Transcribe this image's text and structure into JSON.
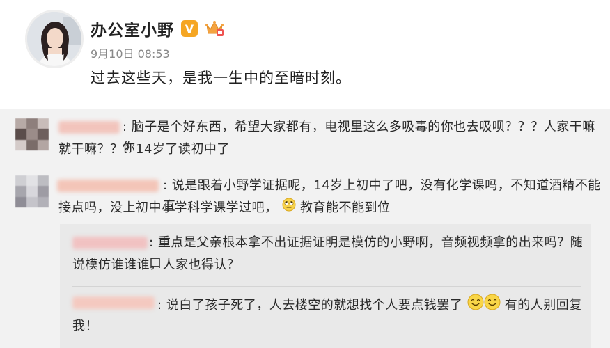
{
  "post": {
    "username": "办公室小野",
    "verified_badge_text": "V",
    "timestamp": "9月10日 08:53",
    "text": "过去这些天，是我一生中的至暗时刻。",
    "icons": [
      "avatar",
      "verified-v-icon",
      "crown-member-icon"
    ]
  },
  "comments": [
    {
      "separator": ":",
      "line1": "脑子是个好东西，希望大家都有，电视里这么多吸毒的你也去吸呗？？？人家干嘛你",
      "line2": "就干嘛？？？14岁了读初中了"
    },
    {
      "separator": ":",
      "line1": "说是跟着小野学证据呢，14岁上初中了吧，没有化学课吗，不知道酒精不能直",
      "line2_before": "接点吗，没上初中小学科学课学过吧，",
      "line2_after": " 教育能不能到位",
      "emoji": "rolling-eyes-emoji"
    }
  ],
  "replies": [
    {
      "separator": ":",
      "line1": "重点是父亲根本拿不出证据证明是模仿的小野啊，音频视频拿的出来吗？随口",
      "line2": "说模仿谁谁谁，人家也得认？"
    },
    {
      "separator": ":",
      "line1_before": "说白了孩子死了，人去楼空的就想找个人要点钱罢了",
      "line1_after": "有的人别回复",
      "line2": "我！",
      "emoji": "smile-emoji"
    }
  ],
  "colors": {
    "background_post": "#ffffff",
    "background_comments": "#f2f2f2",
    "reply_box": "#e9e9e9",
    "verified_badge": "#f5a623",
    "timestamp": "#888888"
  }
}
